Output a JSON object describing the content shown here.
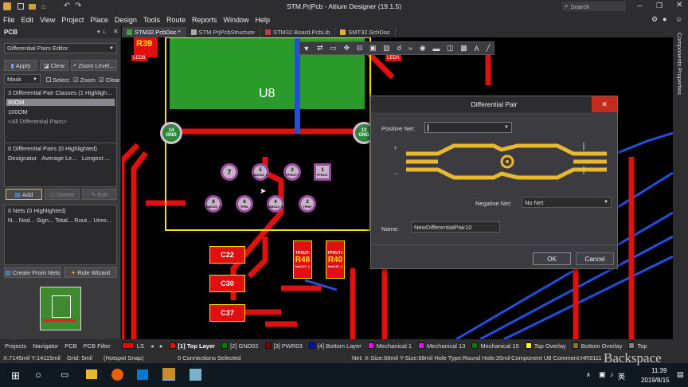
{
  "window": {
    "title": "STM.PrjPcb - Altium Designer (19.1.5)",
    "search_placeholder": "Search",
    "colors": {
      "chrome": "#2d2d30",
      "accent": "#3399ff",
      "close_red": "#c42b1c"
    }
  },
  "menu": [
    "File",
    "Edit",
    "View",
    "Project",
    "Place",
    "Design",
    "Tools",
    "Route",
    "Reports",
    "Window",
    "Help"
  ],
  "panel": {
    "title": "PCB",
    "mode": "Differential Pairs Editor",
    "apply": "Apply",
    "clear": "Clear",
    "zoom_level": "Zoom Level...",
    "mask": "Mask",
    "select": "Select",
    "zoom": "Zoom",
    "clear_existing": "Clear",
    "classes_header": "3 Differential Pair Classes (1 Highligh...",
    "classes": [
      "90OM",
      "100OM",
      "<All Differential Pairs>"
    ],
    "pairs_header": "0 Differential Pairs (0 Highlighted)",
    "pairs_columns": [
      "Designator",
      "Average Le...",
      "Longest ..."
    ],
    "add": "Add",
    "delete": "Delete",
    "edit": "Edit",
    "nets_header": "0 Nets (0 Highlighted)",
    "nets_columns": [
      "N...",
      "Nod...",
      "Sign...",
      "Total...",
      "Rout...",
      "Unro..."
    ],
    "create_from_nets": "Create From Nets",
    "rule_wizard": "Rule Wizard"
  },
  "doc_tabs": [
    "STM32.PcbDoc *",
    "STM.PrjPcbStructure",
    "STM32 Board.PcbLib",
    "SMT32.SchDoc"
  ],
  "right_panels": [
    "Components",
    "Properties"
  ],
  "bottom_panel_tabs": [
    "Projects",
    "Navigator",
    "PCB",
    "PCB Filter"
  ],
  "layers": [
    {
      "label": "LS",
      "color": "#ff0000"
    },
    {
      "label": "[1] Top Layer",
      "color": "#ff0000"
    },
    {
      "label": "[2] GND02",
      "color": "#008000"
    },
    {
      "label": "[3] PWR03",
      "color": "#800000"
    },
    {
      "label": "[4] Bottom Layer",
      "color": "#0000ff"
    },
    {
      "label": "Mechanical 1",
      "color": "#ff00ff"
    },
    {
      "label": "Mechanical 13",
      "color": "#ff00ff"
    },
    {
      "label": "Mechanical 15",
      "color": "#008000"
    },
    {
      "label": "Top Overlay",
      "color": "#ffff00"
    },
    {
      "label": "Bottom Overlay",
      "color": "#808000"
    },
    {
      "label": "Top",
      "color": "#808080"
    }
  ],
  "status": {
    "coords": "X:7145mil Y:14115mil",
    "grid": "Grid: 5mil",
    "snap": "(Hotspot Snap)",
    "connections": "0 Connections Selected",
    "net_info": "Net: X-Size:68mil Y-Size:68mil Hole Type:Round Hole:35mil",
    "component": "Component U8 Comment:HR9111"
  },
  "pcb": {
    "u8_label": "U8",
    "designator_top": "R39",
    "led_b": "LEDB",
    "led_a": "LEDA",
    "pad14": {
      "num": "14",
      "net": "GND"
    },
    "pad13": {
      "num": "13",
      "net": "GND"
    },
    "pads": [
      {
        "num": "7",
        "net": ""
      },
      {
        "num": "5",
        "net": "NetC23_2"
      },
      {
        "num": "3",
        "net": "TPOUT+"
      },
      {
        "num": "1",
        "net": "TPOUT-"
      },
      {
        "num": "8",
        "net": "NetC25_1"
      },
      {
        "num": "6",
        "net": "TPIN-"
      },
      {
        "num": "4",
        "net": "NetC24_1"
      },
      {
        "num": "2",
        "net": "TPIN+"
      }
    ],
    "caps": [
      "C22",
      "C30",
      "C37"
    ],
    "res": [
      {
        "label": "R48",
        "net": "TPOUT-",
        "sub": "NetC37_1"
      },
      {
        "label": "R40",
        "net": "TPOUT+",
        "sub": "NetC37_1"
      }
    ]
  },
  "dialog": {
    "title": "Differential Pair",
    "positive_net_label": "Positive Net:",
    "positive_net_value": "",
    "negative_net_label": "Negative Net:",
    "negative_net_value": "No Net",
    "name_label": "Name:",
    "name_value": "NewDifferentialPair10",
    "ok": "OK",
    "cancel": "Cancel",
    "illustration_color": "#e8b830"
  },
  "taskbar": {
    "time": "11:39",
    "date": "2019/8/15",
    "ime": "英",
    "overlay_text": "Backspace"
  }
}
